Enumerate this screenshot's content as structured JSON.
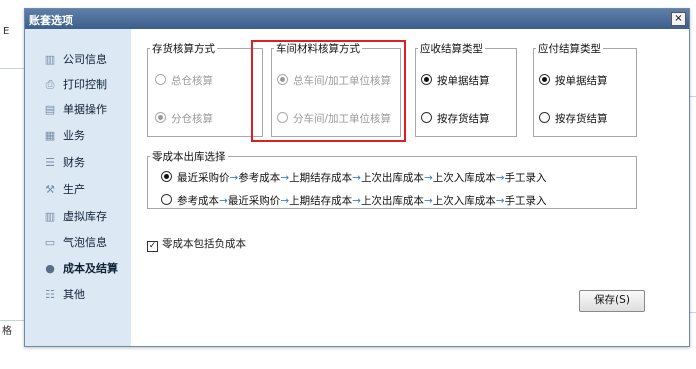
{
  "background": {
    "left_fragment_1": "E",
    "left_fragment_2": "格"
  },
  "dialog": {
    "title": "账套选项",
    "close_label": "×"
  },
  "sidebar": {
    "items": [
      {
        "label": "公司信息",
        "icon": "bar-chart-icon"
      },
      {
        "label": "打印控制",
        "icon": "printer-icon"
      },
      {
        "label": "单据操作",
        "icon": "document-icon"
      },
      {
        "label": "业务",
        "icon": "chart-icon"
      },
      {
        "label": "财务",
        "icon": "coins-icon"
      },
      {
        "label": "生产",
        "icon": "factory-icon"
      },
      {
        "label": "虚拟库存",
        "icon": "inventory-icon"
      },
      {
        "label": "气泡信息",
        "icon": "bubble-icon"
      },
      {
        "label": "成本及结算",
        "icon": "cost-icon"
      },
      {
        "label": "其他",
        "icon": "list-icon"
      }
    ],
    "active": "成本及结算"
  },
  "groups": {
    "inventory_accounting": {
      "legend": "存货核算方式",
      "options": [
        "总仓核算",
        "分仓核算"
      ],
      "selected": "分仓核算"
    },
    "workshop_material": {
      "legend": "车间材料核算方式",
      "options": [
        "总车间/加工单位核算",
        "分车间/加工单位核算"
      ],
      "selected": "总车间/加工单位核算"
    },
    "receivable_settlement": {
      "legend": "应收结算类型",
      "options": [
        "按单据结算",
        "按存货结算"
      ],
      "selected": "按单据结算"
    },
    "payable_settlement": {
      "legend": "应付结算类型",
      "options": [
        "按单据结算",
        "按存货结算"
      ],
      "selected": "按单据结算"
    },
    "zero_cost_outbound": {
      "legend": "零成本出库选择",
      "option1": [
        "最近采购价",
        "参考成本",
        "上期结存成本",
        "上次出库成本",
        "上次入库成本",
        "手工录入"
      ],
      "option2": [
        "参考成本",
        "最近采购价",
        "上期结存成本",
        "上次出库成本",
        "上次入库成本",
        "手工录入"
      ],
      "selected_index": 0,
      "arrow": "→"
    }
  },
  "checkbox": {
    "label": "零成本包括负成本",
    "checked": true
  },
  "save_button": {
    "label": "保存(S)"
  },
  "colors": {
    "highlight_box": "#e02020",
    "title_bar": "#3d5f8c",
    "sidebar_bg": "#dce8f4"
  }
}
